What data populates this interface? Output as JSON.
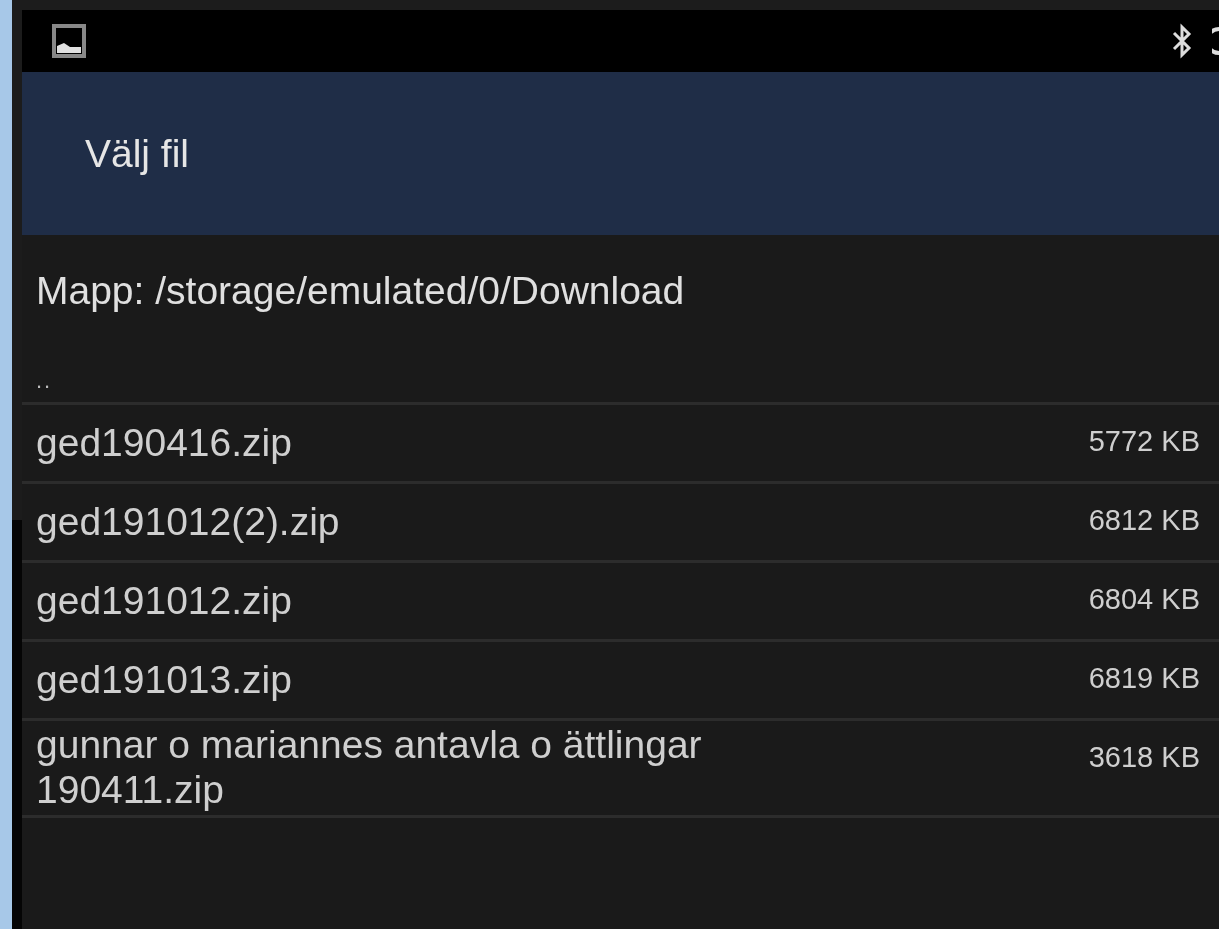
{
  "dialog": {
    "title": "Välj fil"
  },
  "folder": "Mapp: /storage/emulated/0/Download",
  "parent_entry": "..",
  "files": [
    {
      "name": "ged190416.zip",
      "size": "5772 KB"
    },
    {
      "name": "ged191012(2).zip",
      "size": "6812 KB"
    },
    {
      "name": "ged191012.zip",
      "size": "6804 KB"
    },
    {
      "name": "ged191013.zip",
      "size": "6819 KB"
    },
    {
      "name": "gunnar o mariannes antavla o ättlingar 190411.zip",
      "size": "3618 KB"
    }
  ]
}
